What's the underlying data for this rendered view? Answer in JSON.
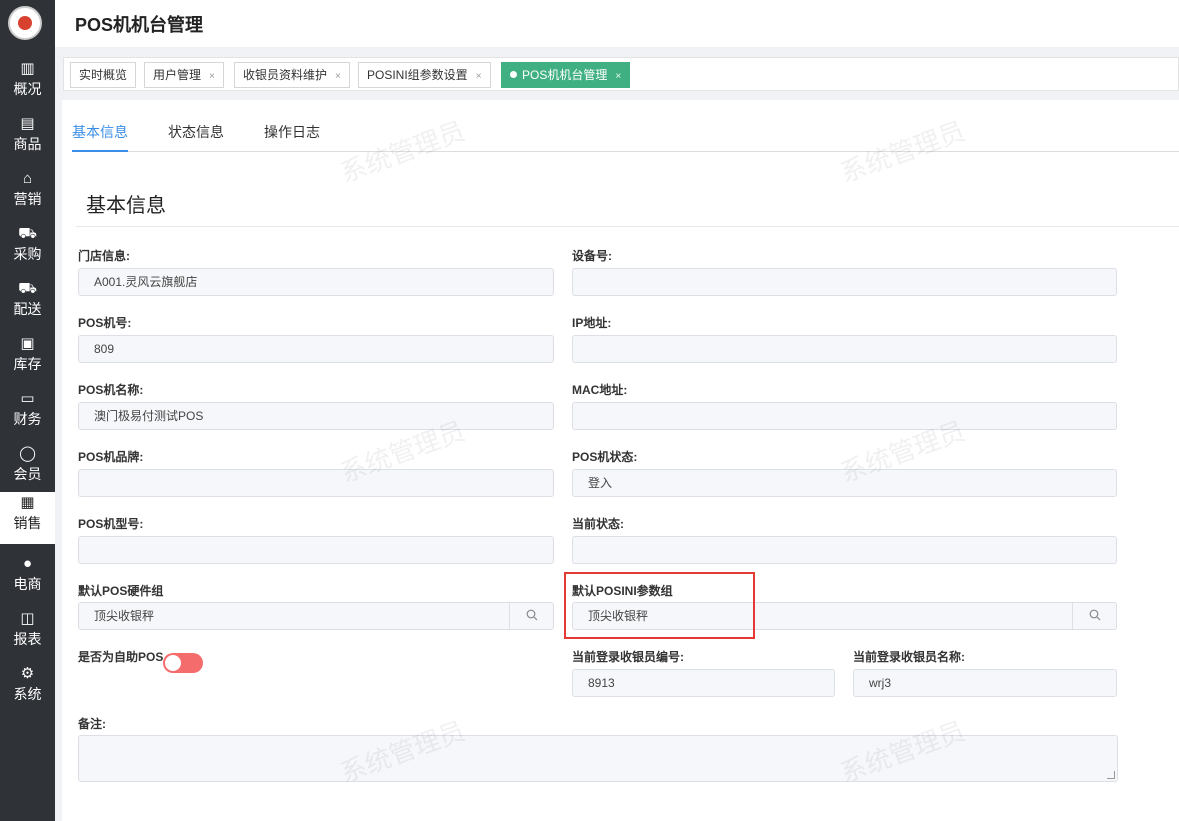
{
  "header": {
    "title": "POS机机台管理"
  },
  "sidebar": {
    "items": [
      {
        "label": "概况",
        "icon": "building-icon",
        "glyph": "▥"
      },
      {
        "label": "商品",
        "icon": "document-icon",
        "glyph": "▤"
      },
      {
        "label": "营销",
        "icon": "bag-icon",
        "glyph": "⌂"
      },
      {
        "label": "采购",
        "icon": "cart-icon",
        "glyph": "⛟"
      },
      {
        "label": "配送",
        "icon": "truck-icon",
        "glyph": "⛟"
      },
      {
        "label": "库存",
        "icon": "box-icon",
        "glyph": "▣"
      },
      {
        "label": "财务",
        "icon": "money-icon",
        "glyph": "▭"
      },
      {
        "label": "会员",
        "icon": "person-icon",
        "glyph": "◯"
      },
      {
        "label": "销售",
        "icon": "register-icon",
        "glyph": "▦"
      },
      {
        "label": "电商",
        "icon": "user-icon",
        "glyph": "●"
      },
      {
        "label": "报表",
        "icon": "chart-icon",
        "glyph": "◫"
      },
      {
        "label": "系统",
        "icon": "gear-icon",
        "glyph": "⚙"
      }
    ]
  },
  "tabs": [
    {
      "label": "实时概览",
      "closable": false
    },
    {
      "label": "用户管理",
      "closable": true
    },
    {
      "label": "收银员资料维护",
      "closable": true
    },
    {
      "label": "POSINI组参数设置",
      "closable": true
    },
    {
      "label": "POS机机台管理",
      "closable": true,
      "active": true
    }
  ],
  "close_glyph": "×",
  "subtabs": [
    "基本信息",
    "状态信息",
    "操作日志"
  ],
  "section_title": "基本信息",
  "fields": {
    "store_info": {
      "label": "门店信息:",
      "value": "A001.灵风云旗舰店"
    },
    "device_no": {
      "label": "设备号:",
      "value": ""
    },
    "pos_no": {
      "label": "POS机号:",
      "value": "809"
    },
    "ip": {
      "label": "IP地址:",
      "value": ""
    },
    "pos_name": {
      "label": "POS机名称:",
      "value": "澳门极易付测试POS"
    },
    "mac": {
      "label": "MAC地址:",
      "value": ""
    },
    "pos_brand": {
      "label": "POS机品牌:",
      "value": ""
    },
    "pos_status": {
      "label": "POS机状态:",
      "value": "登入"
    },
    "pos_model": {
      "label": "POS机型号:",
      "value": ""
    },
    "current_status": {
      "label": "当前状态:",
      "value": ""
    },
    "hardware_group": {
      "label": "默认POS硬件组",
      "value": "顶尖收银秤"
    },
    "posini_group": {
      "label": "默认POSINI参数组",
      "value": "顶尖收银秤"
    },
    "self_service": {
      "label": "是否为自助POS",
      "value": false
    },
    "cashier_no": {
      "label": "当前登录收银员编号:",
      "value": "8913"
    },
    "cashier_name": {
      "label": "当前登录收银员名称:",
      "value": "wrj3"
    },
    "remark": {
      "label": "备注:",
      "value": ""
    }
  },
  "watermark": "系统管理员",
  "colors": {
    "sidebar": "#2f3237",
    "active_tab": "#40b083",
    "accent": "#3a8ee6",
    "toggle_off": "#f56c6c",
    "highlight": "#e53935"
  }
}
